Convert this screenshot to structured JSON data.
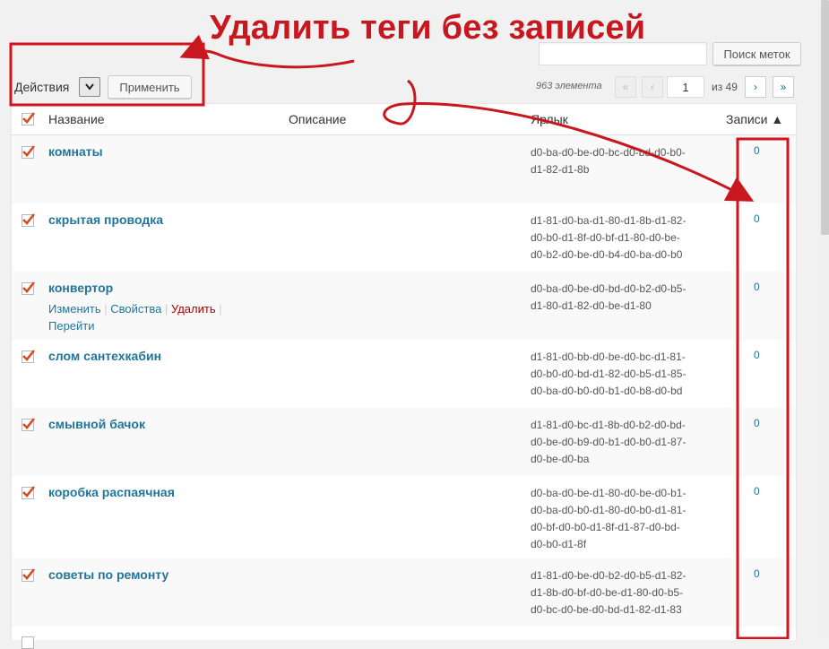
{
  "annotation": {
    "title": "Удалить теги без записей"
  },
  "search": {
    "placeholder": "",
    "button_label": "Поиск меток"
  },
  "bulk": {
    "select_label": "Действия",
    "apply_label": "Применить"
  },
  "pagination": {
    "count_text": "963 элемента",
    "first": "«",
    "prev": "‹",
    "current_page": "1",
    "of_text": "из 49",
    "next": "›",
    "last": "»"
  },
  "table": {
    "headers": {
      "name": "Название",
      "description": "Описание",
      "slug": "Ярлык",
      "posts": "Записи ▲"
    },
    "row_actions": {
      "edit": "Изменить",
      "properties": "Свойства",
      "delete": "Удалить",
      "view": "Перейти"
    },
    "rows": [
      {
        "name": "комнаты",
        "slug": [
          "d0-ba-d0-be-d0-bc-d0-bd-d0-b0-",
          "d1-82-d1-8b"
        ],
        "count": "0"
      },
      {
        "name": "скрытая проводка",
        "slug": [
          "d1-81-d0-ba-d1-80-d1-8b-d1-82-",
          "d0-b0-d1-8f-d0-bf-d1-80-d0-be-",
          "d0-b2-d0-be-d0-b4-d0-ba-d0-b0"
        ],
        "count": "0"
      },
      {
        "name": "конвертор",
        "slug": [
          "d0-ba-d0-be-d0-bd-d0-b2-d0-b5-",
          "d1-80-d1-82-d0-be-d1-80"
        ],
        "count": "0"
      },
      {
        "name": "слом сантехкабин",
        "slug": [
          "d1-81-d0-bb-d0-be-d0-bc-d1-81-",
          "d0-b0-d0-bd-d1-82-d0-b5-d1-85-",
          "d0-ba-d0-b0-d0-b1-d0-b8-d0-bd"
        ],
        "count": "0"
      },
      {
        "name": "смывной бачок",
        "slug": [
          "d1-81-d0-bc-d1-8b-d0-b2-d0-bd-",
          "d0-be-d0-b9-d0-b1-d0-b0-d1-87-",
          "d0-be-d0-ba"
        ],
        "count": "0"
      },
      {
        "name": "коробка распаячная",
        "slug": [
          "d0-ba-d0-be-d1-80-d0-be-d0-b1-",
          "d0-ba-d0-b0-d1-80-d0-b0-d1-81-",
          "d0-bf-d0-b0-d1-8f-d1-87-d0-bd-",
          "d0-b0-d1-8f"
        ],
        "count": "0"
      },
      {
        "name": "советы по ремонту",
        "slug": [
          "d1-81-d0-be-d0-b2-d0-b5-d1-82-",
          "d1-8b-d0-bf-d0-be-d1-80-d0-b5-",
          "d0-bc-d0-be-d0-bd-d1-82-d1-83"
        ],
        "count": "0"
      }
    ]
  },
  "colors": {
    "annotation": "#c8171e",
    "link": "#21759b",
    "delete": "#aa0000",
    "check": "#d54e21"
  }
}
